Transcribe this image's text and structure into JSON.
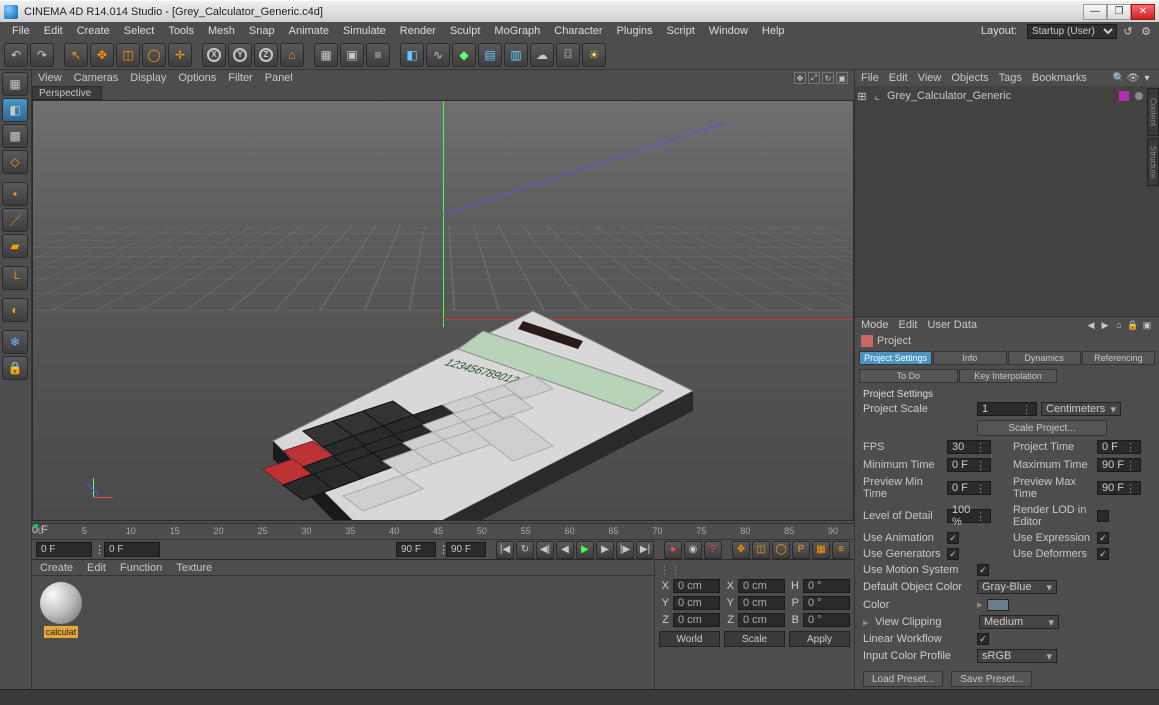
{
  "title": "CINEMA 4D R14.014 Studio - [Grey_Calculator_Generic.c4d]",
  "menubar": [
    "File",
    "Edit",
    "Create",
    "Select",
    "Tools",
    "Mesh",
    "Snap",
    "Animate",
    "Simulate",
    "Render",
    "Sculpt",
    "MoGraph",
    "Character",
    "Plugins",
    "Script",
    "Window",
    "Help"
  ],
  "layout_label": "Layout:",
  "layout_value": "Startup (User)",
  "viewport_menus": [
    "View",
    "Cameras",
    "Display",
    "Options",
    "Filter",
    "Panel"
  ],
  "viewport_tab": "Perspective",
  "timeline": {
    "start_field": "0 F",
    "cur_field": "0 F",
    "end_a": "90 F",
    "end_b": "90 F",
    "ticks": [
      "0",
      "5",
      "10",
      "15",
      "20",
      "25",
      "30",
      "35",
      "40",
      "45",
      "50",
      "55",
      "60",
      "65",
      "70",
      "75",
      "80",
      "85",
      "90"
    ],
    "right_label": "0 F"
  },
  "materials": {
    "menus": [
      "Create",
      "Edit",
      "Function",
      "Texture"
    ],
    "thumb_label": "calculat"
  },
  "coords": {
    "X": "0 cm",
    "Y": "0 cm",
    "Z": "0 cm",
    "sX": "0 cm",
    "sY": "0 cm",
    "sZ": "0 cm",
    "H": "0 °",
    "P": "0 °",
    "B": "0 °",
    "world": "World",
    "scale": "Scale",
    "apply": "Apply"
  },
  "object_manager": {
    "menus": [
      "File",
      "Edit",
      "View",
      "Objects",
      "Tags",
      "Bookmarks"
    ],
    "item": "Grey_Calculator_Generic"
  },
  "attribute": {
    "menus": [
      "Mode",
      "Edit",
      "User Data"
    ],
    "head": "Project",
    "tabs1": [
      "Project Settings",
      "Info",
      "Dynamics",
      "Referencing"
    ],
    "tabs2": [
      "To Do",
      "Key Interpolation"
    ],
    "section": "Project Settings",
    "project_scale_label": "Project Scale",
    "project_scale_value": "1",
    "project_scale_unit": "Centimeters",
    "scale_btn": "Scale Project...",
    "fps_label": "FPS",
    "fps": "30",
    "ptime_label": "Project Time",
    "ptime": "0 F",
    "min_label": "Minimum Time",
    "min": "0 F",
    "max_label": "Maximum Time",
    "max": "90 F",
    "pmin_label": "Preview Min Time",
    "pmin": "0 F",
    "pmax_label": "Preview Max Time",
    "pmax": "90 F",
    "lod_label": "Level of Detail",
    "lod": "100 %",
    "rlod_label": "Render LOD in Editor",
    "anim_label": "Use Animation",
    "expr_label": "Use Expression",
    "gen_label": "Use Generators",
    "def_label": "Use Deformers",
    "motion_label": "Use Motion System",
    "doc_label": "Default Object Color",
    "doc_val": "Gray-Blue",
    "color_label": "Color",
    "vc_label": "View Clipping",
    "vc_val": "Medium",
    "lw_label": "Linear Workflow",
    "icp_label": "Input Color Profile",
    "icp_val": "sRGB",
    "load_btn": "Load Preset...",
    "save_btn": "Save Preset..."
  }
}
